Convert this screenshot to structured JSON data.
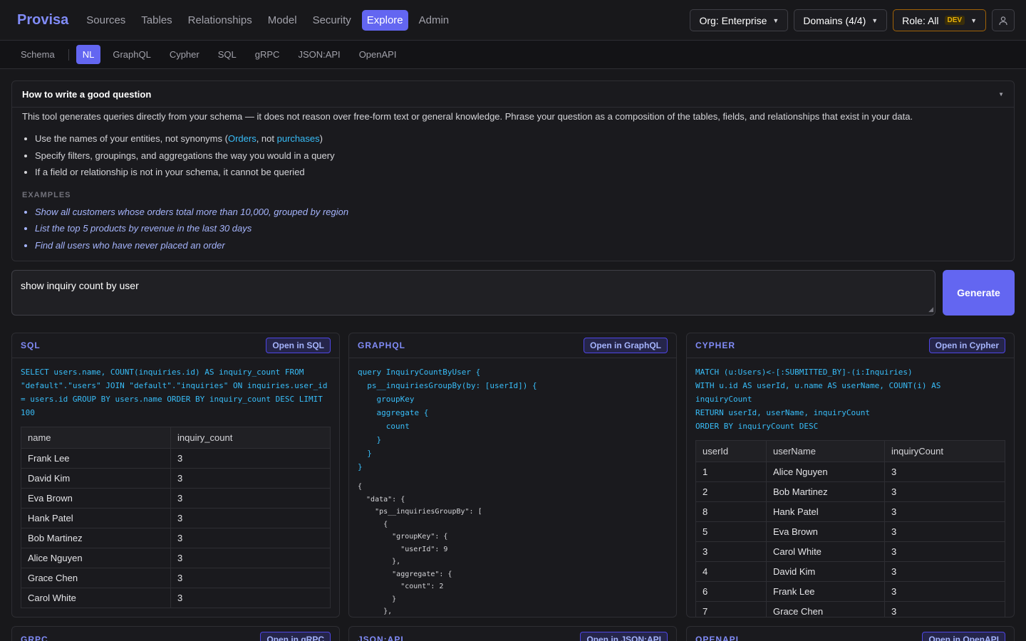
{
  "app": {
    "name": "Provisa"
  },
  "nav": [
    "Sources",
    "Tables",
    "Relationships",
    "Model",
    "Security",
    "Explore",
    "Admin"
  ],
  "controls": {
    "org": "Org: Enterprise",
    "domains": "Domains (4/4)",
    "role": "Role: All",
    "role_badge": "DEV"
  },
  "subnav": {
    "schema": "Schema",
    "tabs": [
      "NL",
      "GraphQL",
      "Cypher",
      "SQL",
      "gRPC",
      "JSON:API",
      "OpenAPI"
    ]
  },
  "howto": {
    "title": "How to write a good question",
    "intro": "This tool generates queries directly from your schema — it does not reason over free-form text or general knowledge. Phrase your question as a composition of the tables, fields, and relationships that exist in your data.",
    "tip1_prefix": "Use the names of your entities, not synonyms (",
    "tip1_orders": "Orders",
    "tip1_mid": ", not ",
    "tip1_purchases": "purchases",
    "tip1_suffix": ")",
    "tip2": "Specify filters, groupings, and aggregations the way you would in a query",
    "tip3": "If a field or relationship is not in your schema, it cannot be queried",
    "examples_label": "EXAMPLES",
    "examples": [
      "Show all customers whose orders total more than 10,000, grouped by region",
      "List the top 5 products by revenue in the last 30 days",
      "Find all users who have never placed an order"
    ]
  },
  "query": {
    "text": "show inquiry count by user",
    "generate": "Generate"
  },
  "sql": {
    "title": "SQL",
    "open": "Open in SQL",
    "code": "SELECT users.name, COUNT(inquiries.id) AS inquiry_count FROM \"default\".\"users\" JOIN \"default\".\"inquiries\" ON inquiries.user_id = users.id GROUP BY users.name ORDER BY inquiry_count DESC LIMIT 100",
    "columns": [
      "name",
      "inquiry_count"
    ],
    "rows": [
      [
        "Frank Lee",
        "3"
      ],
      [
        "David Kim",
        "3"
      ],
      [
        "Eva Brown",
        "3"
      ],
      [
        "Hank Patel",
        "3"
      ],
      [
        "Bob Martinez",
        "3"
      ],
      [
        "Alice Nguyen",
        "3"
      ],
      [
        "Grace Chen",
        "3"
      ],
      [
        "Carol White",
        "3"
      ]
    ]
  },
  "graphql": {
    "title": "GRAPHQL",
    "open": "Open in GraphQL",
    "code": "query InquiryCountByUser {\n  ps__inquiriesGroupBy(by: [userId]) {\n    groupKey\n    aggregate {\n      count\n    }\n  }\n}",
    "result": "{\n  \"data\": {\n    \"ps__inquiriesGroupBy\": [\n      {\n        \"groupKey\": {\n          \"userId\": 9\n        },\n        \"aggregate\": {\n          \"count\": 2\n        }\n      },"
  },
  "cypher": {
    "title": "CYPHER",
    "open": "Open in Cypher",
    "code": "MATCH (u:Users)<-[:SUBMITTED_BY]-(i:Inquiries)\nWITH u.id AS userId, u.name AS userName, COUNT(i) AS\ninquiryCount\nRETURN userId, userName, inquiryCount\nORDER BY inquiryCount DESC",
    "columns": [
      "userId",
      "userName",
      "inquiryCount"
    ],
    "rows": [
      [
        "1",
        "Alice Nguyen",
        "3"
      ],
      [
        "2",
        "Bob Martinez",
        "3"
      ],
      [
        "8",
        "Hank Patel",
        "3"
      ],
      [
        "5",
        "Eva Brown",
        "3"
      ],
      [
        "3",
        "Carol White",
        "3"
      ],
      [
        "4",
        "David Kim",
        "3"
      ],
      [
        "6",
        "Frank Lee",
        "3"
      ],
      [
        "7",
        "Grace Chen",
        "3"
      ]
    ]
  },
  "bottom_panels": [
    {
      "title": "GRPC",
      "open": "Open in gRPC"
    },
    {
      "title": "JSON:API",
      "open": "Open in JSON:API"
    },
    {
      "title": "OPENAPI",
      "open": "Open in OpenAPI"
    }
  ]
}
